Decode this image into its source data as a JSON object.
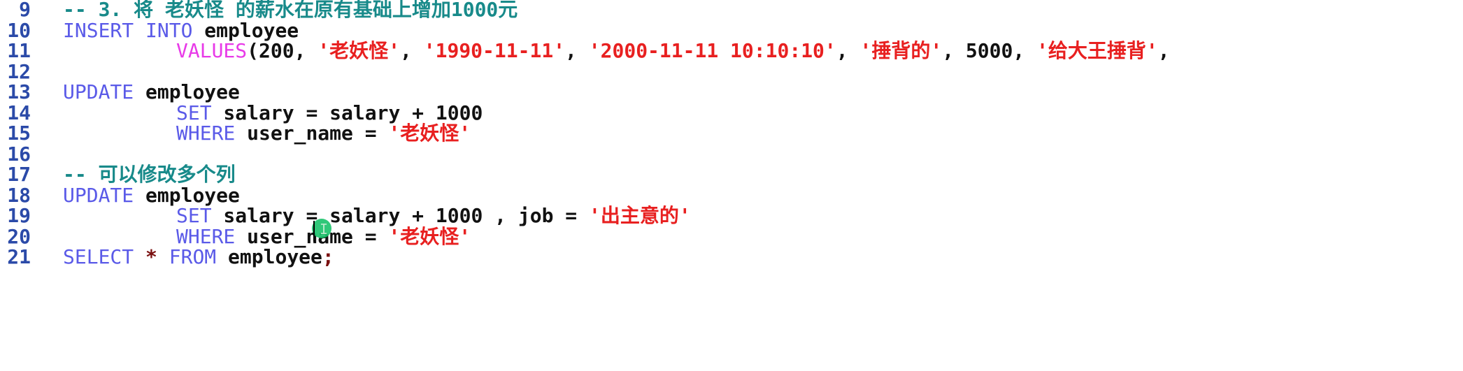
{
  "editor": {
    "lines": [
      {
        "num": "9",
        "tokens": [
          {
            "t": "-- 3. 将 老妖怪 的薪水在原有基础上增加1000元",
            "c": "cm"
          }
        ]
      },
      {
        "num": "10",
        "tokens": [
          {
            "t": "INSERT INTO",
            "c": "kw"
          },
          {
            "t": " employee",
            "c": "id"
          }
        ]
      },
      {
        "num": "11",
        "indent": true,
        "tokens": [
          {
            "t": "VALUES",
            "c": "fn"
          },
          {
            "t": "(200, ",
            "c": "id"
          },
          {
            "t": "'老妖怪'",
            "c": "str"
          },
          {
            "t": ", ",
            "c": "id"
          },
          {
            "t": "'1990-11-11'",
            "c": "str"
          },
          {
            "t": ", ",
            "c": "id"
          },
          {
            "t": "'2000-11-11 10:10:10'",
            "c": "str"
          },
          {
            "t": ", ",
            "c": "id"
          },
          {
            "t": "'捶背的'",
            "c": "str"
          },
          {
            "t": ", 5000, ",
            "c": "id"
          },
          {
            "t": "'给大王捶背'",
            "c": "str"
          },
          {
            "t": ",",
            "c": "id"
          }
        ]
      },
      {
        "num": "12",
        "tokens": []
      },
      {
        "num": "13",
        "tokens": [
          {
            "t": "UPDATE",
            "c": "kw"
          },
          {
            "t": " employee",
            "c": "id"
          }
        ]
      },
      {
        "num": "14",
        "indent": true,
        "tokens": [
          {
            "t": "SET",
            "c": "kw"
          },
          {
            "t": " salary = salary + 1000",
            "c": "id"
          }
        ]
      },
      {
        "num": "15",
        "indent": true,
        "tokens": [
          {
            "t": "WHERE",
            "c": "kw"
          },
          {
            "t": " user_name = ",
            "c": "id"
          },
          {
            "t": "'老妖怪'",
            "c": "str"
          }
        ]
      },
      {
        "num": "16",
        "tokens": []
      },
      {
        "num": "17",
        "tokens": [
          {
            "t": "-- 可以修改多个列",
            "c": "cm"
          }
        ]
      },
      {
        "num": "18",
        "tokens": [
          {
            "t": "UPDATE",
            "c": "kw"
          },
          {
            "t": " employee",
            "c": "id"
          }
        ]
      },
      {
        "num": "19",
        "indent": true,
        "tokens": [
          {
            "t": "SET",
            "c": "kw"
          },
          {
            "t": " salary = salary + 1000 , job = ",
            "c": "id"
          },
          {
            "t": "'出主意的'",
            "c": "str"
          }
        ]
      },
      {
        "num": "20",
        "indent": true,
        "tokens": [
          {
            "t": "WHERE",
            "c": "kw"
          },
          {
            "t": " user_name = ",
            "c": "id"
          },
          {
            "t": "'老妖怪'",
            "c": "str"
          }
        ]
      },
      {
        "num": "21",
        "tokens": [
          {
            "t": "SELECT",
            "c": "kw"
          },
          {
            "t": " * ",
            "c": "op"
          },
          {
            "t": "FROM",
            "c": "kw"
          },
          {
            "t": " employee",
            "c": "id"
          },
          {
            "t": ";",
            "c": "op"
          }
        ]
      }
    ]
  },
  "colors": {
    "keyword": "#5a5ae8",
    "function": "#e83ae8",
    "string": "#e82020",
    "comment": "#188a8a",
    "line_number": "#2b4aa8",
    "cursor_highlight": "#19c26a"
  },
  "icons": {
    "cursor": "text-cursor-icon"
  }
}
